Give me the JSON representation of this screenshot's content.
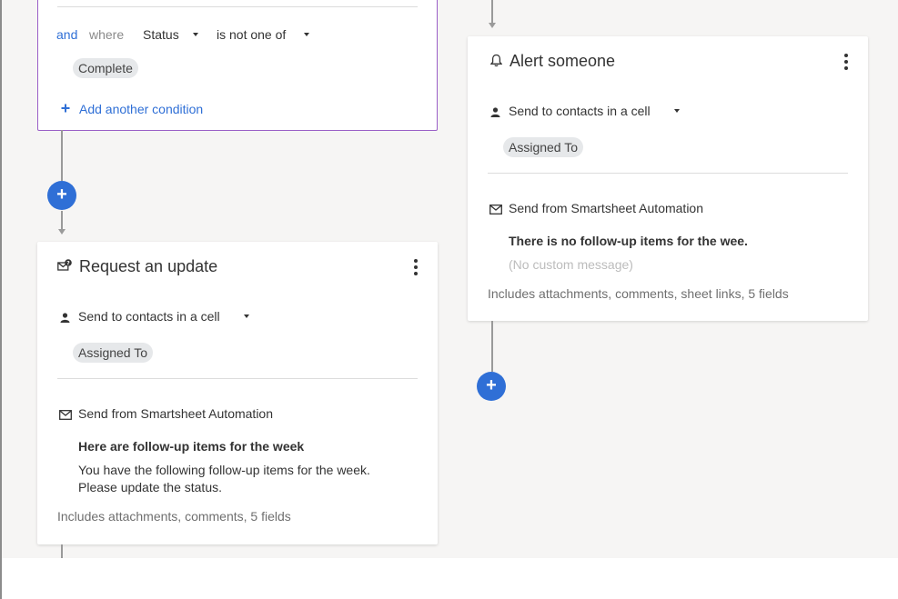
{
  "condition_card": {
    "conjunction": "and",
    "where": "where",
    "field": "Status",
    "operator": "is not one of",
    "value_chip": "Complete",
    "add_condition_label": "Add another condition"
  },
  "request_card": {
    "title": "Request an update",
    "recipient_dropdown": "Send to contacts in a cell",
    "recipient_chip": "Assigned To",
    "sender": "Send from Smartsheet Automation",
    "subject": "Here are follow-up items for the week",
    "message_line1": "You have the following follow-up items for the week.",
    "message_line2": "Please update the status.",
    "includes": "Includes attachments, comments, 5 fields"
  },
  "alert_card": {
    "title": "Alert someone",
    "recipient_dropdown": "Send to contacts in a cell",
    "recipient_chip": "Assigned To",
    "sender": "Send from Smartsheet Automation",
    "subject": "There is no follow-up items for the wee.",
    "message_placeholder": "(No custom message)",
    "includes": "Includes attachments, comments, sheet links, 5 fields"
  },
  "add_step_label": "+",
  "colors": {
    "accent_blue": "#2f6fd6",
    "condition_border": "#9a5fc7",
    "canvas_bg": "#f6f5f4",
    "connector": "#9a9a9a"
  },
  "icons": {
    "person": "person-icon",
    "envelope": "envelope-icon",
    "request": "envelope-question-icon",
    "alert": "bell-icon",
    "menu": "more-vertical-icon",
    "add": "plus-icon"
  }
}
